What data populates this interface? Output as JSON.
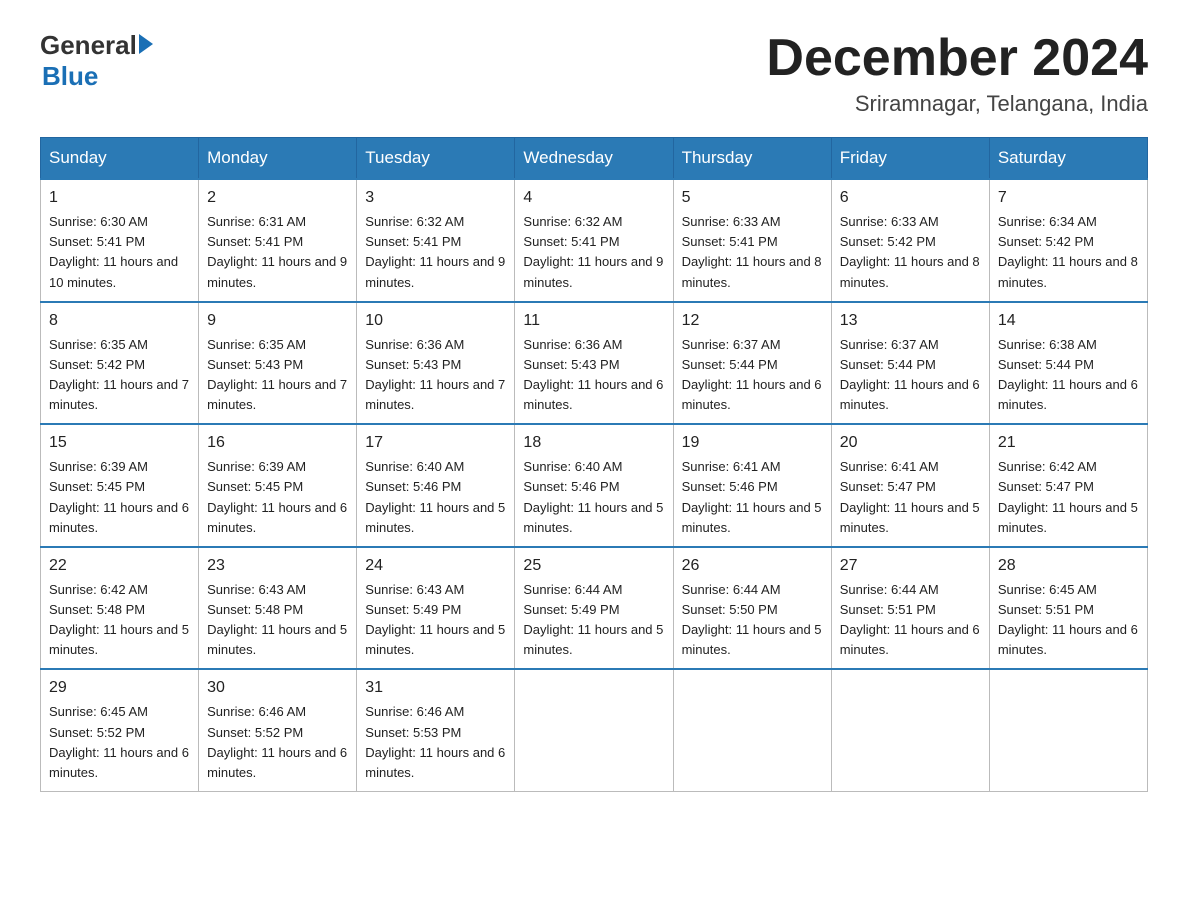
{
  "logo": {
    "general": "General",
    "blue": "Blue"
  },
  "header": {
    "month": "December 2024",
    "location": "Sriramnagar, Telangana, India"
  },
  "weekdays": [
    "Sunday",
    "Monday",
    "Tuesday",
    "Wednesday",
    "Thursday",
    "Friday",
    "Saturday"
  ],
  "weeks": [
    [
      {
        "day": "1",
        "sunrise": "6:30 AM",
        "sunset": "5:41 PM",
        "daylight": "11 hours and 10 minutes."
      },
      {
        "day": "2",
        "sunrise": "6:31 AM",
        "sunset": "5:41 PM",
        "daylight": "11 hours and 9 minutes."
      },
      {
        "day": "3",
        "sunrise": "6:32 AM",
        "sunset": "5:41 PM",
        "daylight": "11 hours and 9 minutes."
      },
      {
        "day": "4",
        "sunrise": "6:32 AM",
        "sunset": "5:41 PM",
        "daylight": "11 hours and 9 minutes."
      },
      {
        "day": "5",
        "sunrise": "6:33 AM",
        "sunset": "5:41 PM",
        "daylight": "11 hours and 8 minutes."
      },
      {
        "day": "6",
        "sunrise": "6:33 AM",
        "sunset": "5:42 PM",
        "daylight": "11 hours and 8 minutes."
      },
      {
        "day": "7",
        "sunrise": "6:34 AM",
        "sunset": "5:42 PM",
        "daylight": "11 hours and 8 minutes."
      }
    ],
    [
      {
        "day": "8",
        "sunrise": "6:35 AM",
        "sunset": "5:42 PM",
        "daylight": "11 hours and 7 minutes."
      },
      {
        "day": "9",
        "sunrise": "6:35 AM",
        "sunset": "5:43 PM",
        "daylight": "11 hours and 7 minutes."
      },
      {
        "day": "10",
        "sunrise": "6:36 AM",
        "sunset": "5:43 PM",
        "daylight": "11 hours and 7 minutes."
      },
      {
        "day": "11",
        "sunrise": "6:36 AM",
        "sunset": "5:43 PM",
        "daylight": "11 hours and 6 minutes."
      },
      {
        "day": "12",
        "sunrise": "6:37 AM",
        "sunset": "5:44 PM",
        "daylight": "11 hours and 6 minutes."
      },
      {
        "day": "13",
        "sunrise": "6:37 AM",
        "sunset": "5:44 PM",
        "daylight": "11 hours and 6 minutes."
      },
      {
        "day": "14",
        "sunrise": "6:38 AM",
        "sunset": "5:44 PM",
        "daylight": "11 hours and 6 minutes."
      }
    ],
    [
      {
        "day": "15",
        "sunrise": "6:39 AM",
        "sunset": "5:45 PM",
        "daylight": "11 hours and 6 minutes."
      },
      {
        "day": "16",
        "sunrise": "6:39 AM",
        "sunset": "5:45 PM",
        "daylight": "11 hours and 6 minutes."
      },
      {
        "day": "17",
        "sunrise": "6:40 AM",
        "sunset": "5:46 PM",
        "daylight": "11 hours and 5 minutes."
      },
      {
        "day": "18",
        "sunrise": "6:40 AM",
        "sunset": "5:46 PM",
        "daylight": "11 hours and 5 minutes."
      },
      {
        "day": "19",
        "sunrise": "6:41 AM",
        "sunset": "5:46 PM",
        "daylight": "11 hours and 5 minutes."
      },
      {
        "day": "20",
        "sunrise": "6:41 AM",
        "sunset": "5:47 PM",
        "daylight": "11 hours and 5 minutes."
      },
      {
        "day": "21",
        "sunrise": "6:42 AM",
        "sunset": "5:47 PM",
        "daylight": "11 hours and 5 minutes."
      }
    ],
    [
      {
        "day": "22",
        "sunrise": "6:42 AM",
        "sunset": "5:48 PM",
        "daylight": "11 hours and 5 minutes."
      },
      {
        "day": "23",
        "sunrise": "6:43 AM",
        "sunset": "5:48 PM",
        "daylight": "11 hours and 5 minutes."
      },
      {
        "day": "24",
        "sunrise": "6:43 AM",
        "sunset": "5:49 PM",
        "daylight": "11 hours and 5 minutes."
      },
      {
        "day": "25",
        "sunrise": "6:44 AM",
        "sunset": "5:49 PM",
        "daylight": "11 hours and 5 minutes."
      },
      {
        "day": "26",
        "sunrise": "6:44 AM",
        "sunset": "5:50 PM",
        "daylight": "11 hours and 5 minutes."
      },
      {
        "day": "27",
        "sunrise": "6:44 AM",
        "sunset": "5:51 PM",
        "daylight": "11 hours and 6 minutes."
      },
      {
        "day": "28",
        "sunrise": "6:45 AM",
        "sunset": "5:51 PM",
        "daylight": "11 hours and 6 minutes."
      }
    ],
    [
      {
        "day": "29",
        "sunrise": "6:45 AM",
        "sunset": "5:52 PM",
        "daylight": "11 hours and 6 minutes."
      },
      {
        "day": "30",
        "sunrise": "6:46 AM",
        "sunset": "5:52 PM",
        "daylight": "11 hours and 6 minutes."
      },
      {
        "day": "31",
        "sunrise": "6:46 AM",
        "sunset": "5:53 PM",
        "daylight": "11 hours and 6 minutes."
      },
      null,
      null,
      null,
      null
    ]
  ]
}
